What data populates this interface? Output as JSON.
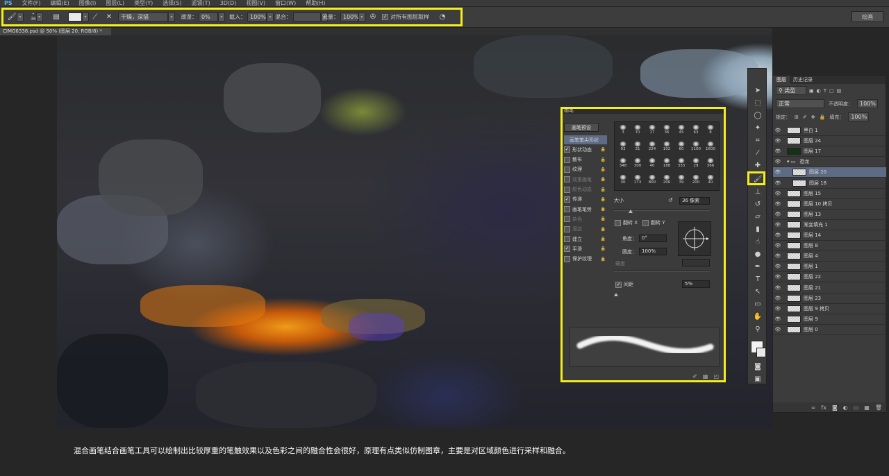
{
  "app": {
    "logo": "PS"
  },
  "menu": [
    "文件(F)",
    "编辑(E)",
    "图像(I)",
    "图层(L)",
    "类型(Y)",
    "选择(S)",
    "滤镜(T)",
    "3D(D)",
    "视图(V)",
    "窗口(W)",
    "帮助(H)"
  ],
  "options_bar": {
    "brush_size": "36",
    "mode_value": "干燥，深描",
    "wet_label": "潮湿：",
    "wet_value": "0%",
    "load_label": "载入：",
    "load_value": "100%",
    "mix_label": "混合：",
    "mix_value": "",
    "flow_label": "流量：",
    "flow_value": "100%",
    "sample_all_label": "对所有图层取样",
    "sample_all_checked": "✓",
    "workspace_label": "绘画"
  },
  "document": {
    "tab_title": "CIMG6338.psd @ 50% (图层 20, RGB/8) *"
  },
  "brush_panel": {
    "header": "画笔",
    "preset_button": "画笔预设",
    "options": [
      {
        "label": "画笔笔尖形状",
        "checked": "",
        "dim": false,
        "selected": true
      },
      {
        "label": "形状动态",
        "checked": "✓",
        "dim": false,
        "selected": false
      },
      {
        "label": "散布",
        "checked": "",
        "dim": false,
        "selected": false
      },
      {
        "label": "纹理",
        "checked": "",
        "dim": false,
        "selected": false
      },
      {
        "label": "双重画笔",
        "checked": "",
        "dim": true,
        "selected": false
      },
      {
        "label": "颜色动态",
        "checked": "",
        "dim": true,
        "selected": false
      },
      {
        "label": "传递",
        "checked": "✓",
        "dim": false,
        "selected": false
      },
      {
        "label": "画笔笔势",
        "checked": "",
        "dim": false,
        "selected": false
      },
      {
        "label": "杂色",
        "checked": "",
        "dim": true,
        "selected": false
      },
      {
        "label": "湿边",
        "checked": "",
        "dim": true,
        "selected": false
      },
      {
        "label": "建立",
        "checked": "",
        "dim": false,
        "selected": false
      },
      {
        "label": "平滑",
        "checked": "✓",
        "dim": false,
        "selected": false
      },
      {
        "label": "保护纹理",
        "checked": "",
        "dim": false,
        "selected": false
      }
    ],
    "tips": [
      "3",
      "70",
      "17",
      "36",
      "45",
      "63",
      "8",
      "93",
      "31",
      "224",
      "102",
      "60",
      "1100",
      "1600",
      "348",
      "300",
      "40",
      "188",
      "333",
      "29",
      "366",
      "30",
      "173",
      "800",
      "200",
      "39",
      "200",
      "40"
    ],
    "size_label": "大小",
    "size_value": "36 像素",
    "flip_x": "翻转 X",
    "flip_y": "翻转 Y",
    "angle_label": "角度：",
    "angle_value": "0°",
    "roundness_label": "圆度：",
    "roundness_value": "100%",
    "hardness_label": "硬度",
    "spacing_label": "间距",
    "spacing_checked": "✓",
    "spacing_value": "5%"
  },
  "layers_panel": {
    "tabs": [
      "图层",
      "历史记录"
    ],
    "filter_label": "类型",
    "blend_mode": "正常",
    "opacity_label": "不透明度：",
    "opacity_value": "100%",
    "lock_label": "锁定：",
    "fill_label": "填充：",
    "fill_value": "100%",
    "layers": [
      {
        "name": "黑白 1",
        "selected": false
      },
      {
        "name": "图层 24",
        "selected": false
      },
      {
        "name": "图层 17",
        "selected": false
      },
      {
        "name": "恐龙",
        "selected": false
      },
      {
        "name": "图层 20",
        "selected": true
      },
      {
        "name": "图层 18",
        "selected": false
      },
      {
        "name": "图层 15",
        "selected": false
      },
      {
        "name": "图层 10 拷贝",
        "selected": false
      },
      {
        "name": "图层 13",
        "selected": false
      },
      {
        "name": "渐变填充 1",
        "selected": false
      },
      {
        "name": "图层 14",
        "selected": false
      },
      {
        "name": "图层 8",
        "selected": false
      },
      {
        "name": "图层 4",
        "selected": false
      },
      {
        "name": "图层 1",
        "selected": false
      },
      {
        "name": "图层 22",
        "selected": false
      },
      {
        "name": "图层 21",
        "selected": false
      },
      {
        "name": "图层 23",
        "selected": false
      },
      {
        "name": "图层 9 拷贝",
        "selected": false
      },
      {
        "name": "图层 9",
        "selected": false
      },
      {
        "name": "图层 0",
        "selected": false
      }
    ]
  },
  "caption": "混合画笔结合画笔工具可以绘制出比较厚重的笔触效果以及色彩之间的融合性会很好，原理有点类似仿制图章，主要是对区域颜色进行采样和融合。",
  "colors": {
    "highlight": "#f5ee1a",
    "selection": "#5d6c84"
  }
}
